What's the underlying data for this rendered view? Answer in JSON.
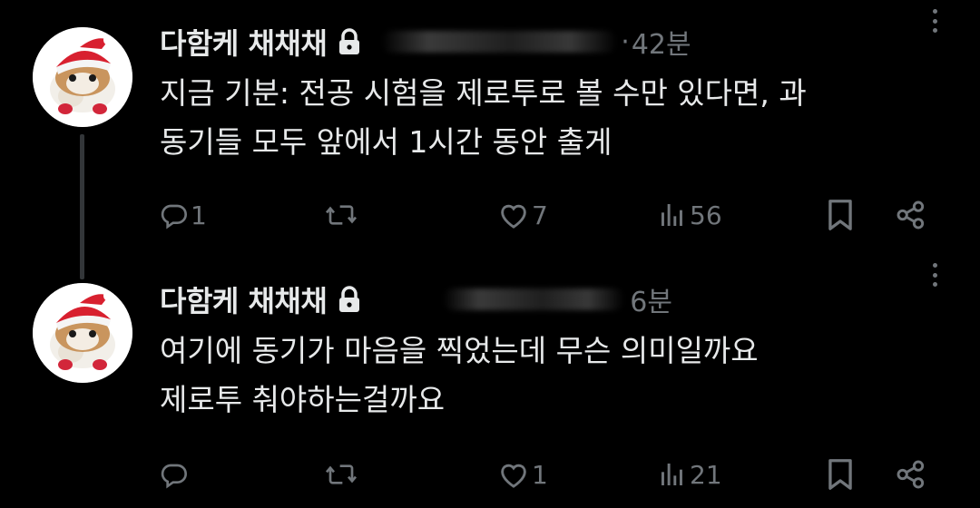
{
  "tweets": [
    {
      "display_name": "다함케 채채채",
      "separator": "·",
      "time": "42분",
      "text_lines": [
        "지금 기분: 전공 시험을 제로투로 볼 수만 있다면, 과",
        "동기들 모두 앞에서 1시간 동안 출게"
      ],
      "reply_count": "1",
      "retweet_count": "",
      "like_count": "7",
      "view_count": "56"
    },
    {
      "display_name": "다함케 채채채",
      "separator": "",
      "time": "6분",
      "text_lines": [
        "여기에 동기가 마음을 찍었는데 무슨 의미일까요",
        "제로투 춰야하는걸까요"
      ],
      "reply_count": "",
      "retweet_count": "",
      "like_count": "1",
      "view_count": "21"
    }
  ],
  "icons": {
    "lock": "lock-icon",
    "more": "more-icon",
    "reply": "reply-icon",
    "retweet": "retweet-icon",
    "like": "heart-icon",
    "views": "views-icon",
    "bookmark": "bookmark-icon",
    "share": "share-icon"
  },
  "colors": {
    "background": "#000000",
    "text": "#e7e9ea",
    "secondary": "#71767b",
    "thread_line": "#333639"
  }
}
